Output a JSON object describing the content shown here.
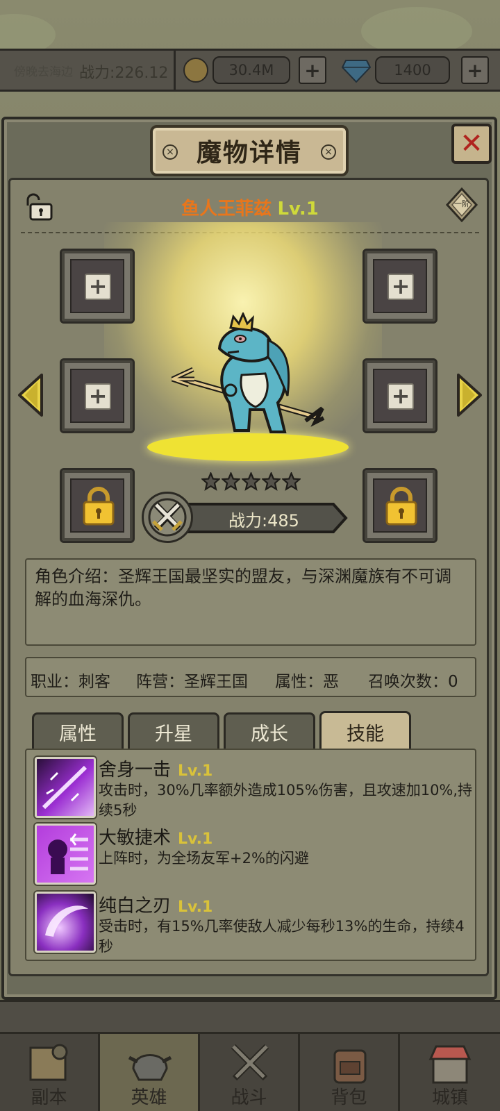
{
  "top_bar": {
    "left_text": "傍晚去海边",
    "power_label": "战力:226.12",
    "gold_amount": "30.4M",
    "gem_amount": "1400",
    "plus_symbol": "+"
  },
  "panel": {
    "title": "魔物详情",
    "close_symbol": "✕"
  },
  "hero": {
    "name": "鱼人王菲兹",
    "level": "Lv.1",
    "rank": "一阶",
    "stars": 5,
    "power": "战力:485"
  },
  "description": "角色介绍：圣辉王国最坚实的盟友，与深渊魔族有不可调解的血海深仇。",
  "stats": {
    "job": "职业：刺客",
    "faction": "阵营：圣辉王国",
    "attribute": "属性：恶",
    "summons": "召唤次数：0"
  },
  "tabs": [
    "属性",
    "升星",
    "成长",
    "技能"
  ],
  "active_tab": "技能",
  "skills": [
    {
      "name": "舍身一击",
      "level": "Lv.1",
      "desc": "攻击时，30%几率额外造成105%伤害，且攻速加10%,持续5秒"
    },
    {
      "name": "大敏捷术",
      "level": "Lv.1",
      "desc": "上阵时，为全场友军+2%的闪避"
    },
    {
      "name": "纯白之刃",
      "level": "Lv.1",
      "desc": "受击时，有15%几率使敌人减少每秒13%的生命，持续4秒"
    }
  ],
  "nav": [
    "副本",
    "英雄",
    "战斗",
    "背包",
    "城镇"
  ],
  "active_nav": "英雄",
  "colors": {
    "hero_name": "#e8761c",
    "level": "#cfd93a",
    "close_x": "#b0231e"
  }
}
